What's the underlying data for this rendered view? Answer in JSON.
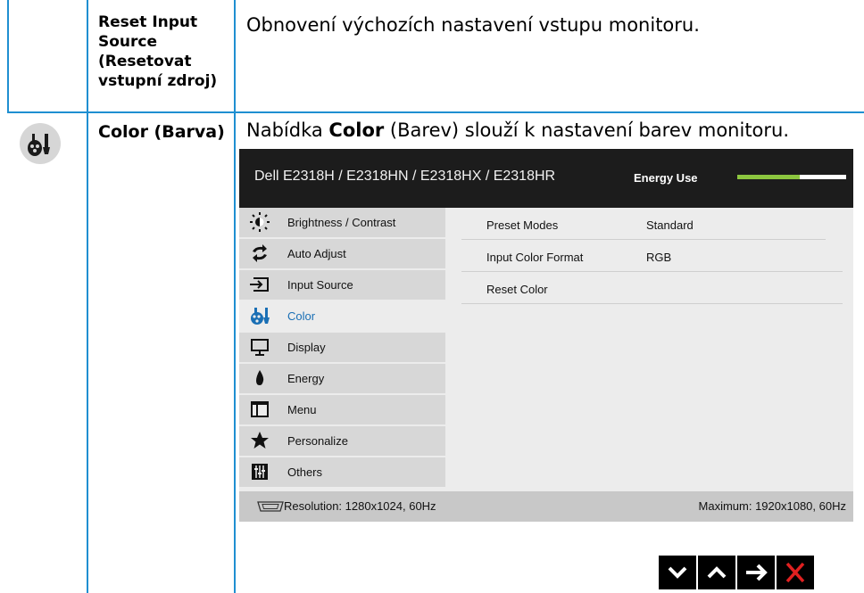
{
  "rows": [
    {
      "name": "Reset Input Source (Resetovat vstupní zdroj)",
      "description": "Obnovení výchozích nastavení vstupu monitoru."
    },
    {
      "icon": "color-palette-icon",
      "name": "Color (Barva)",
      "description_prefix": "Nabídka ",
      "description_bold": "Color",
      "description_suffix": " (Barev) slouží k nastavení barev monitoru."
    }
  ],
  "osd": {
    "title": "Dell E2318H / E2318HN / E2318HX / E2318HR",
    "energy_label": "Energy Use",
    "energy_level_fraction": 0.57,
    "accent_color": "#8cc63f",
    "active_color": "#1a6fb5",
    "menu_items": [
      {
        "label": "Brightness / Contrast",
        "icon": "brightness-icon"
      },
      {
        "label": "Auto Adjust",
        "icon": "auto-adjust-icon"
      },
      {
        "label": "Input Source",
        "icon": "input-source-icon"
      },
      {
        "label": "Color",
        "icon": "color-icon",
        "active": true
      },
      {
        "label": "Display",
        "icon": "display-icon"
      },
      {
        "label": "Energy",
        "icon": "energy-icon"
      },
      {
        "label": "Menu",
        "icon": "menu-icon"
      },
      {
        "label": "Personalize",
        "icon": "star-icon"
      },
      {
        "label": "Others",
        "icon": "others-icon"
      }
    ],
    "submenu": [
      {
        "label": "Preset Modes",
        "value": "Standard"
      },
      {
        "label": "Input Color Format",
        "value": "RGB"
      },
      {
        "label": "Reset Color",
        "value": ""
      }
    ],
    "footer": {
      "resolution": "Resolution: 1280x1024, 60Hz",
      "maximum": "Maximum: 1920x1080, 60Hz"
    }
  },
  "nav_buttons": [
    "chevron-down-icon",
    "chevron-up-icon",
    "arrow-right-icon",
    "close-icon"
  ]
}
